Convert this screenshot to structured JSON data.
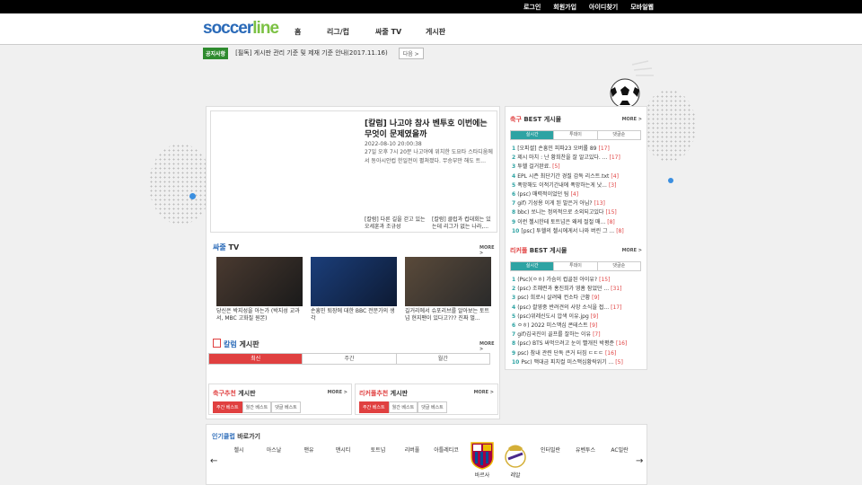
{
  "topbar": {
    "links": [
      "로그인",
      "회원가입",
      "아이디찾기",
      "모바일웹"
    ]
  },
  "header": {
    "logo_a": "soccer",
    "logo_b": "line",
    "nav": [
      "홈",
      "리그/컵",
      "싸줄 TV",
      "게시판"
    ]
  },
  "notice": {
    "badge": "공지사항",
    "text": "[필독] 게시판 관리 기준 및 제재 기준 안내(2017.11.16)",
    "more": "다음 >"
  },
  "featured": {
    "title": "[칼럼] 나고야 참사 벤투호 이번에는 무엇이 문제였을까",
    "date": "2022-08-10 20:00:38",
    "desc": "27일 오후 7시 20분 나고야에 위치한 도요타 스타디움에서 동아시안컵 한일전이 펼쳐졌다. 무승부만 해도 트...",
    "sub1": "[칼럼] 다른 길을 걷고 있는 오세훈과 조규성",
    "sub2": "[칼럼] 클럽과 컵대회는 있는데 리그가 없는 나라,..."
  },
  "tv": {
    "title_hl": "싸줄",
    "title_rest": " TV",
    "more": "MORE >",
    "videos": [
      "당신은 박지성을 아는가 (박지성 교과서, MBC 고화질 원본)",
      "손흥민 퇴장에 대한 BBC 전문가의 생각",
      "길거리에서 슈포리브를 알아보는 토트넘 현지팬이 있다고??? 진짜 멀..."
    ]
  },
  "column": {
    "title_hl": "칼럼",
    "title_rest": " 게시판",
    "more": "MORE >",
    "tabs": [
      "최신",
      "주간",
      "월간"
    ]
  },
  "soccer_rec": {
    "title_hl": "축구추천",
    "title_rest": " 게시판",
    "more": "MORE >",
    "tabs": [
      "주간 베스트",
      "월간 베스트",
      "댓글 베스트"
    ]
  },
  "league_rec": {
    "title_hl": "리커풀추천",
    "title_rest": " 게시판",
    "more": "MORE >",
    "tabs": [
      "주간 베스트",
      "월간 베스트",
      "댓글 베스트"
    ]
  },
  "soccer_best": {
    "title_hl": "축구",
    "title_rest": " BEST 게시물",
    "more": "MORE >",
    "tabs": [
      "실시간",
      "투데이",
      "댓글순"
    ],
    "items": [
      {
        "n": "1",
        "t": "[오피셜] 손흥민 피파23 오버롤 89",
        "c": "[17]"
      },
      {
        "n": "2",
        "t": "제시 마치 : 난 황희찬을 잘 알고있다. ...",
        "c": "[17]"
      },
      {
        "n": "3",
        "t": "투헬 걸거완료.",
        "c": "[5]"
      },
      {
        "n": "4",
        "t": "EPL 시즌 최단기간 경질 감독 리스트.txt",
        "c": "[4]"
      },
      {
        "n": "5",
        "t": "폭망해도 이적기간내에 폭망하는게 낫...",
        "c": "[3]"
      },
      {
        "n": "6",
        "t": "(psc) 매력적이었던 팀",
        "c": "[4]"
      },
      {
        "n": "7",
        "t": "gif) 기성용 이게 된 발은거 아님?",
        "c": "[13]"
      },
      {
        "n": "8",
        "t": "bbc) 쏘니는 정의적으로 소외되고있다",
        "c": "[15]"
      },
      {
        "n": "9",
        "t": "이런 첼시한테 토트넘은 왜케 절절 매...",
        "c": "[8]"
      },
      {
        "n": "10",
        "t": "[psc] 투헬의 첼시에게서 나와 버린 그 ...",
        "c": "[8]"
      }
    ]
  },
  "league_best": {
    "title_hl": "리커풀",
    "title_rest": " BEST 게시물",
    "more": "MORE >",
    "tabs": [
      "실시간",
      "투데이",
      "댓글순"
    ],
    "items": [
      {
        "n": "1",
        "t": "(Psc)(ㅇㅎ) 가슴이 컵골된 아이유?",
        "c": "[15]"
      },
      {
        "n": "2",
        "t": "(psc) 조혜련과 홍진희가 영흠 잠었던 ...",
        "c": "[31]"
      },
      {
        "n": "3",
        "t": "psc) 희로시 살려돼 컨소타 근황",
        "c": "[9]"
      },
      {
        "n": "4",
        "t": "(psc) 촬영중 반려견의 사망 소식을 접...",
        "c": "[17]"
      },
      {
        "n": "5",
        "t": "(psc)위레신도시 압색 이유.jpg",
        "c": "[9]"
      },
      {
        "n": "6",
        "t": "ㅇㅎ) 2022 미스맥심 콘테스트",
        "c": "[9]"
      },
      {
        "n": "7",
        "t": "gif)김국진이 골프를 잘하는 이유",
        "c": "[7]"
      },
      {
        "n": "8",
        "t": "(psc) BTS 싸먹으려고 눈이 빨개진 박평준",
        "c": "[16]"
      },
      {
        "n": "9",
        "t": "psc) 참내 관련 단독 큰거 터짐 ㄷㄷㄷ",
        "c": "[16]"
      },
      {
        "n": "10",
        "t": "Psc) 맥대금 피치컬 미스맥심황락위기 ...",
        "c": "[5]"
      }
    ]
  },
  "clubs": {
    "title_hl": "인기클럽",
    "title_rest": " 바로가기",
    "names": [
      "첼시",
      "아스날",
      "맨유",
      "맨시티",
      "토트넘",
      "리버풀",
      "아틀레티코",
      "바르사",
      "레알",
      "인터밀란",
      "유벤투스",
      "AC밀란"
    ],
    "prev": "←",
    "next": "→"
  },
  "colors": {
    "accent_red": "#e04040",
    "accent_teal": "#2ea3a3",
    "accent_blue": "#2a6ab8",
    "notice_green": "#2e8b2e"
  }
}
